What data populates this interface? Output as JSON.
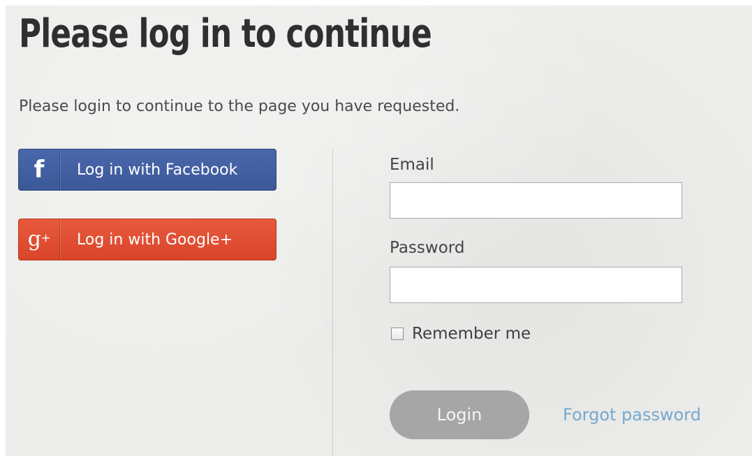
{
  "page": {
    "title": "Please log in to continue",
    "subtitle": "Please login to continue to the page you have requested."
  },
  "social": {
    "facebook": {
      "icon": "f",
      "icon_name": "facebook-icon",
      "label": "Log in with Facebook",
      "color": "#3b5998"
    },
    "google": {
      "icon": "g",
      "icon_sup": "+",
      "icon_name": "google-plus-icon",
      "label": "Log in with Google+",
      "color": "#dd4b39"
    }
  },
  "form": {
    "email_label": "Email",
    "email_value": "",
    "password_label": "Password",
    "password_value": "",
    "remember_label": "Remember me",
    "remember_checked": false,
    "login_label": "Login",
    "forgot_label": "Forgot password"
  },
  "colors": {
    "background": "#ececea",
    "heading": "#2f2f2f",
    "link": "#76a9cf",
    "login_button": "#a6a6a6"
  }
}
